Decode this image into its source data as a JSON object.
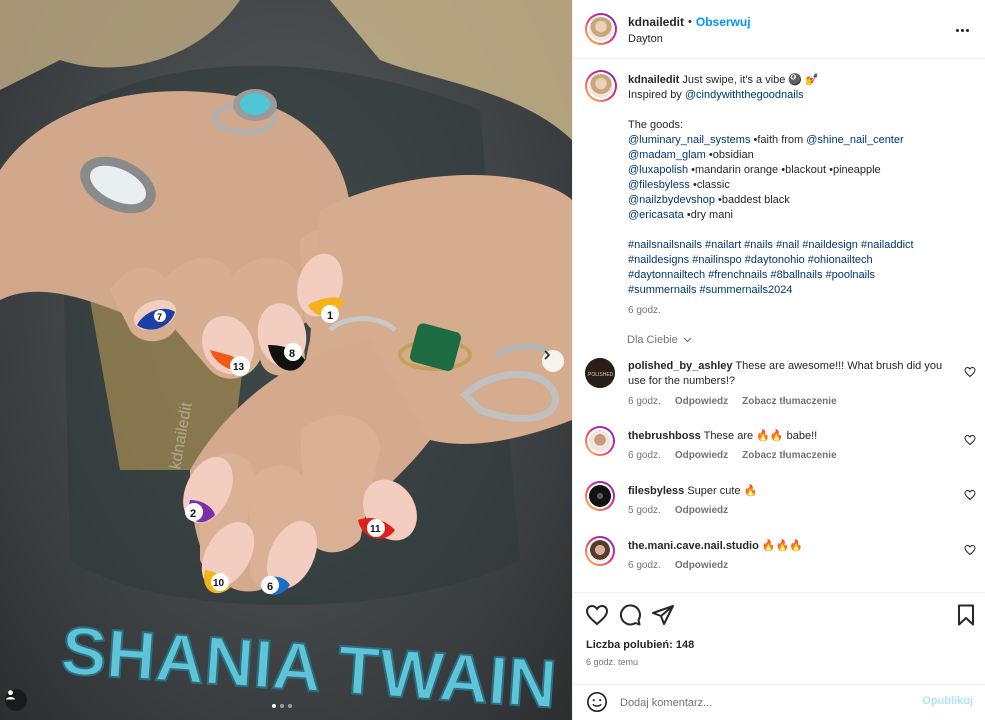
{
  "photo": {
    "alt_watermark": "kdnailedit",
    "shirt_text": "SHANIA TWAIN",
    "carousel_dots": 3,
    "active_dot": 1,
    "nail_numbers": [
      "7",
      "13",
      "8",
      "1",
      "2",
      "10",
      "6",
      "11"
    ]
  },
  "header": {
    "username": "kdnailedit",
    "separator": "•",
    "follow_label": "Obserwuj",
    "location": "Dayton",
    "more_icon": "more-horizontal-icon"
  },
  "caption": {
    "username": "kdnailedit",
    "line1_text": "Just swipe, it's a vibe 🎱 💅",
    "inspired_prefix": "Inspired by ",
    "inspired_mention": "@cindywiththegoodnails",
    "goods_heading": "The goods:",
    "goods": [
      {
        "mention": "@luminary_nail_systems",
        "text": " •faith from ",
        "mention2": "@shine_nail_center"
      },
      {
        "mention": "@madam_glam",
        "text": " •obsidian",
        "mention2": ""
      },
      {
        "mention": "@luxapolish",
        "text": " •mandarin orange •blackout •pineapple",
        "mention2": ""
      },
      {
        "mention": "@filesbyless",
        "text": " •classic",
        "mention2": ""
      },
      {
        "mention": "@nailzbydevshop",
        "text": " •baddest black",
        "mention2": ""
      },
      {
        "mention": "@ericasata",
        "text": " •dry mani",
        "mention2": ""
      }
    ],
    "hashtags": [
      "#nailsnailsnails #nailart #nails #nail #naildesign #nailaddict",
      "#naildesigns #nailinspo #daytonohio #ohionailtech",
      "#daytonnailtech #frenchnails #8ballnails #poolnails",
      "#summernails #summernails2024"
    ],
    "time": "6 godz."
  },
  "for_you_label": "Dla Ciebie",
  "comments": [
    {
      "username": "polished_by_ashley",
      "text": "These are awesome!!! What brush did you use for the numbers!?",
      "time": "6 godz.",
      "reply": "Odpowiedz",
      "translate": "Zobacz tłumaczenie",
      "avatar_color": "#3a2a20"
    },
    {
      "username": "thebrushboss",
      "text": "These are 🔥🔥 babe!!",
      "time": "6 godz.",
      "reply": "Odpowiedz",
      "translate": "Zobacz tłumaczenie",
      "avatar_color": "#c99a7a"
    },
    {
      "username": "filesbyless",
      "text": "Super cute 🔥",
      "time": "5 godz.",
      "reply": "Odpowiedz",
      "translate": "",
      "avatar_color": "#111111"
    },
    {
      "username": "the.mani.cave.nail.studio",
      "text": "🔥🔥🔥",
      "time": "6 godz.",
      "reply": "Odpowiedz",
      "translate": "",
      "avatar_color": "#7a5a4a"
    }
  ],
  "actions": {
    "likes_label": "Liczba polubień: 148",
    "time_ago": "6 godz. temu"
  },
  "add_comment": {
    "placeholder": "Dodaj komentarz...",
    "post_label": "Opublikuj"
  }
}
